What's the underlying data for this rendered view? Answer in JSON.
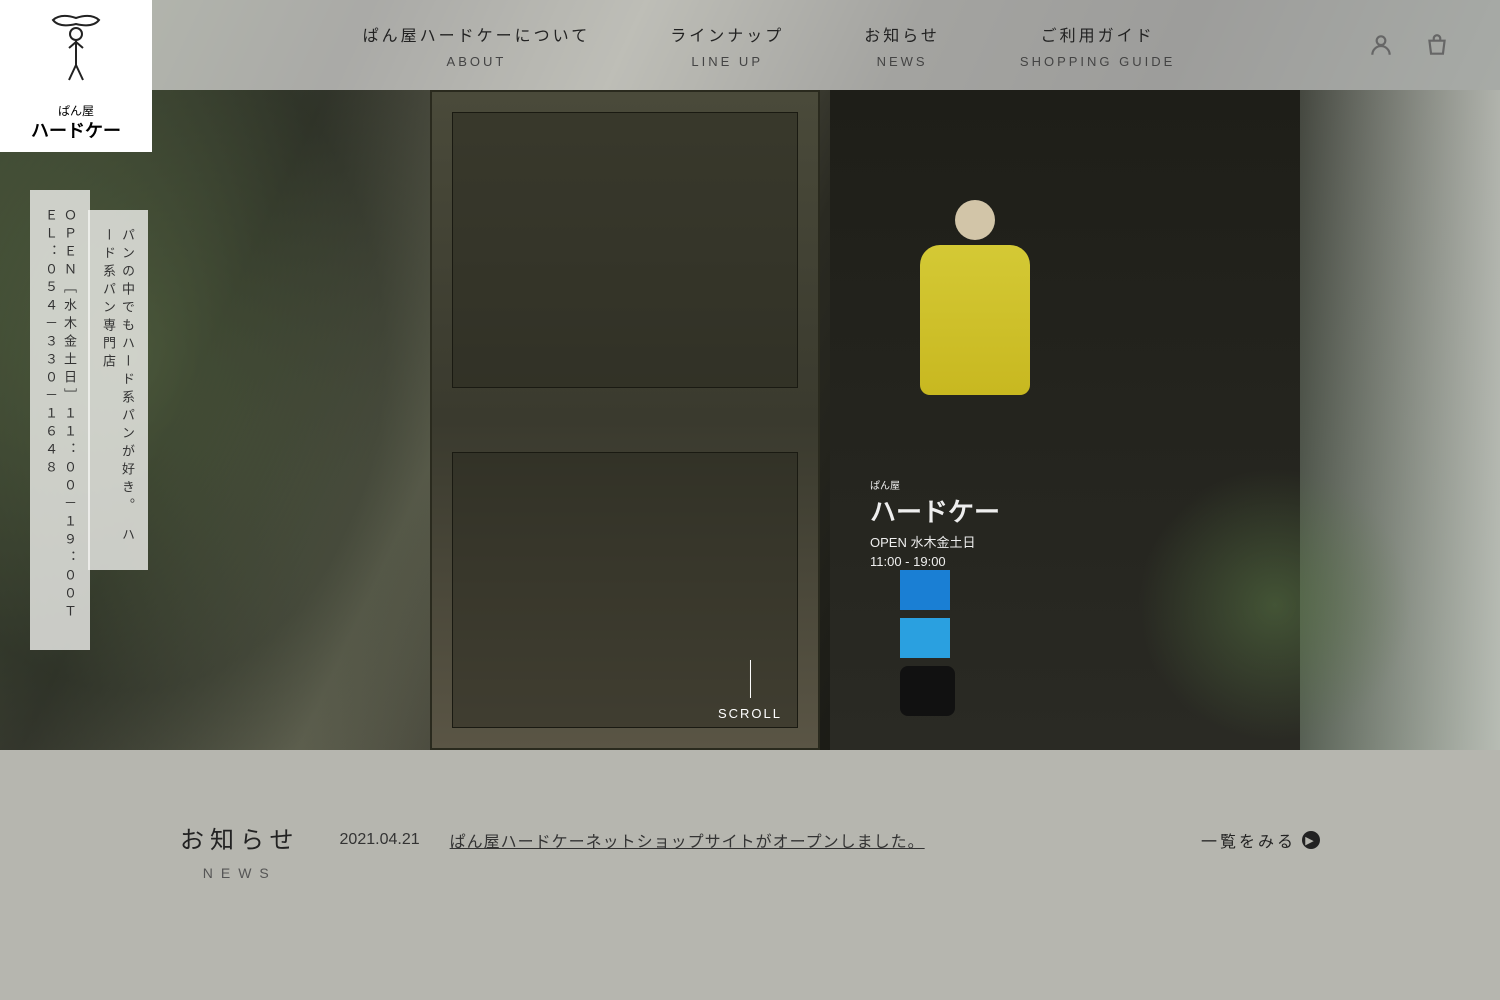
{
  "logo": {
    "sub": "ぱん屋",
    "main": "ハードケー"
  },
  "nav": [
    {
      "jp": "ぱん屋ハードケーについて",
      "en": "ABOUT"
    },
    {
      "jp": "ラインナップ",
      "en": "LINE UP"
    },
    {
      "jp": "お知らせ",
      "en": "NEWS"
    },
    {
      "jp": "ご利用ガイド",
      "en": "SHOPPING GUIDE"
    }
  ],
  "side": {
    "tab1": "ＯＰＥＮ［水木金土日］１１：００－１９：００ＴＥＬ：０５４－３３０－１６４８",
    "tab2": "パンの中でもハード系パンが好き。　ハード系パン専門店"
  },
  "storeSign": {
    "sub": "ぱん屋",
    "main": "ハードケー",
    "open": "OPEN 水木金土日",
    "hours": "11:00 - 19:00"
  },
  "scroll": "SCROLL",
  "news": {
    "heading_jp": "お知らせ",
    "heading_en": "NEWS",
    "item": {
      "date": "2021.04.21",
      "title": "ぱん屋ハードケーネットショップサイトがオープンしました。"
    },
    "more": "一覧をみる"
  }
}
